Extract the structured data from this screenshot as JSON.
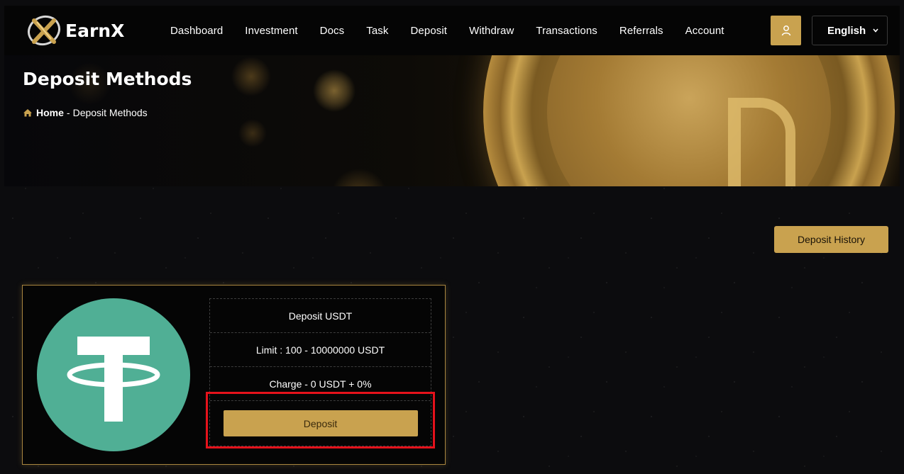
{
  "brand": {
    "name_prefix": "Earn",
    "name_suffix": "X"
  },
  "nav": {
    "items": [
      "Dashboard",
      "Investment",
      "Docs",
      "Task",
      "Deposit",
      "Withdraw",
      "Transactions",
      "Referrals",
      "Account"
    ]
  },
  "language": {
    "selected": "English"
  },
  "hero": {
    "title": "Deposit Methods",
    "breadcrumb_home": "Home",
    "breadcrumb_separator": "-",
    "breadcrumb_current": "Deposit Methods"
  },
  "actions": {
    "history_label": "Deposit History"
  },
  "method": {
    "name": "Deposit USDT",
    "limit": "Limit : 100 - 10000000 USDT",
    "charge": "Charge - 0 USDT + 0%",
    "deposit_label": "Deposit"
  },
  "colors": {
    "accent_gold": "#c9a24f",
    "tether_green": "#50af95",
    "highlight_red": "#e5121b",
    "background": "#0c0c0e"
  },
  "icons": {
    "logo": "earnx-logo-icon",
    "user": "user-icon",
    "dropdown": "chevron-down-icon",
    "home": "home-icon",
    "method": "tether-usdt-icon"
  }
}
